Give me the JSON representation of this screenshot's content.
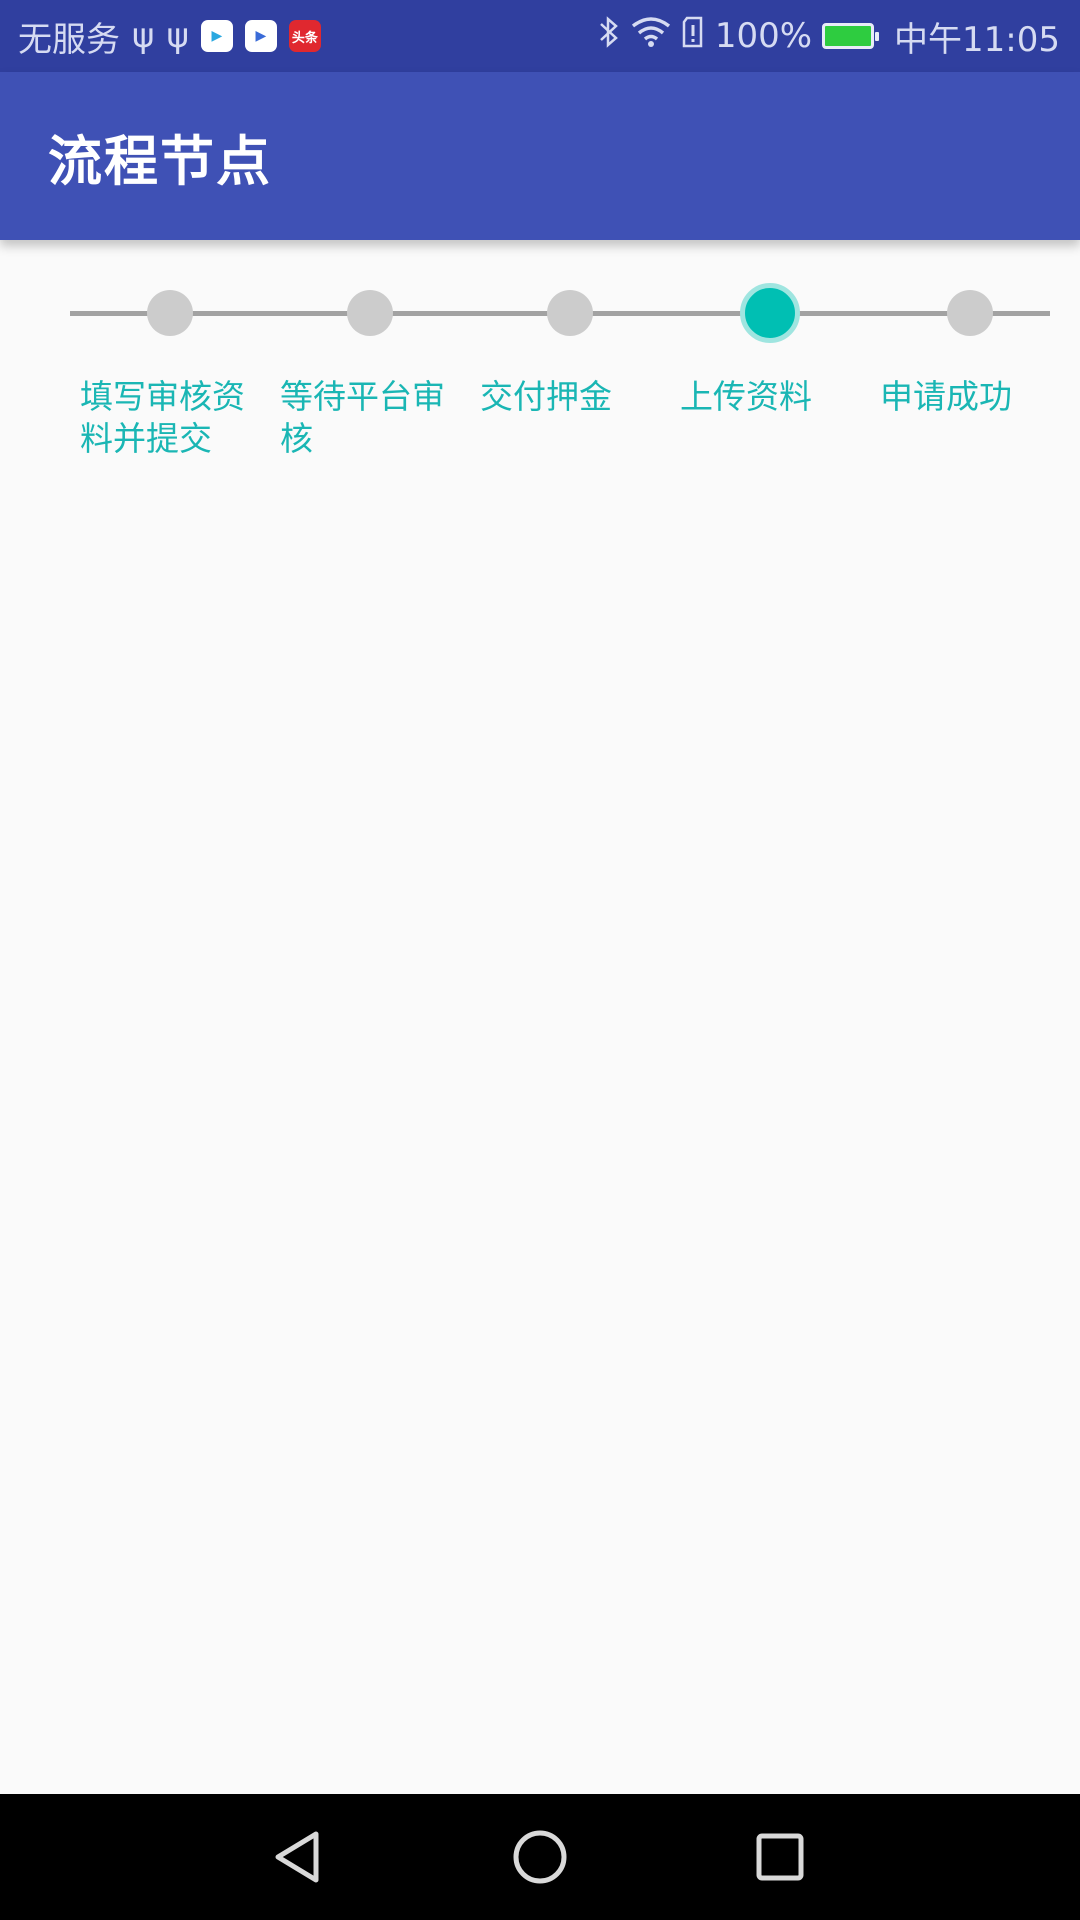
{
  "status_bar": {
    "carrier": "无服务",
    "battery_percent": "100%",
    "time": "中午11:05",
    "icons": [
      "usb-icon",
      "usb-icon",
      "video-app-icon",
      "video-app-icon",
      "toutiao-app-icon",
      "bluetooth-icon",
      "wifi-icon",
      "sim-alert-icon",
      "battery-charging-icon"
    ],
    "news_app_label": "头条"
  },
  "app_bar": {
    "title": "流程节点",
    "background": "#3f51b5"
  },
  "stepper": {
    "active_index": 3,
    "active_color": "#00bfb3",
    "inactive_color": "#cccccc",
    "label_color": "#1ab6b4",
    "steps": [
      {
        "label": "填写审核资料并提交"
      },
      {
        "label": "等待平台审核"
      },
      {
        "label": "交付押金"
      },
      {
        "label": "上传资料"
      },
      {
        "label": "申请成功"
      }
    ]
  },
  "nav_bar": {
    "buttons": [
      "back-icon",
      "home-icon",
      "recents-icon"
    ]
  }
}
